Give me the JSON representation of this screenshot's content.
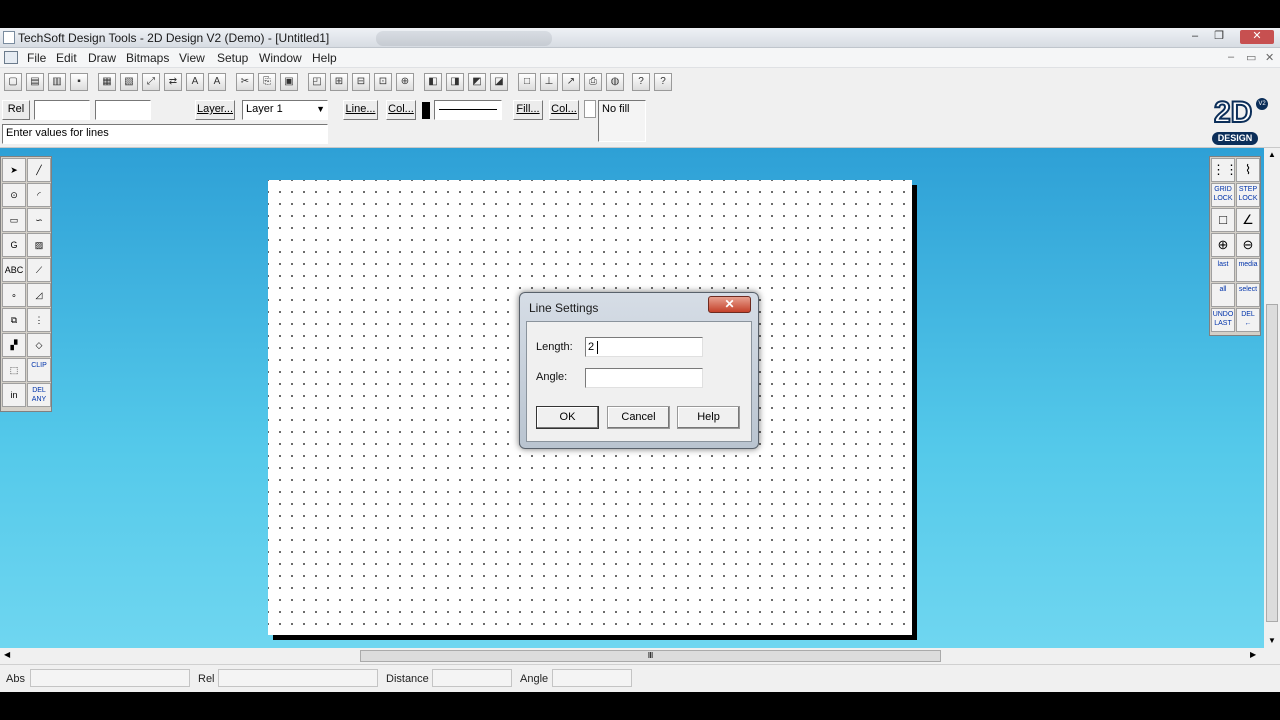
{
  "window": {
    "title": "TechSoft Design Tools - 2D Design V2 (Demo) - [Untitled1]",
    "controls": {
      "minimize": "–",
      "restore": "❐",
      "close": "✕"
    },
    "mdi_controls": {
      "minimize": "–",
      "restore": "▭",
      "close": "✕"
    }
  },
  "menu": {
    "items": [
      "File",
      "Edit",
      "Draw",
      "Bitmaps",
      "View",
      "Setup",
      "Window",
      "Help"
    ]
  },
  "toolbar": {
    "buttons": [
      {
        "name": "new-icon",
        "glyph": "▢"
      },
      {
        "name": "open-icon",
        "glyph": "▤"
      },
      {
        "name": "open-folder-icon",
        "glyph": "▥"
      },
      {
        "name": "save-icon",
        "glyph": "▪"
      },
      {
        "name": "print-icon",
        "glyph": "▦"
      },
      {
        "name": "print-preview-icon",
        "glyph": "▧"
      },
      {
        "name": "rotate-icon",
        "glyph": "⤢"
      },
      {
        "name": "mirror-icon",
        "glyph": "⇄"
      },
      {
        "name": "text-tool-icon",
        "glyph": "A"
      },
      {
        "name": "text-style-icon",
        "glyph": "A"
      },
      {
        "name": "cut-icon",
        "glyph": "✂"
      },
      {
        "name": "copy-icon",
        "glyph": "⎘"
      },
      {
        "name": "paste-icon",
        "glyph": "▣"
      },
      {
        "name": "select-icon",
        "glyph": "◰"
      },
      {
        "name": "group-icon",
        "glyph": "⊞"
      },
      {
        "name": "ungroup-icon",
        "glyph": "⊟"
      },
      {
        "name": "align-icon",
        "glyph": "⊡"
      },
      {
        "name": "distribute-icon",
        "glyph": "⊕"
      },
      {
        "name": "bring-front-icon",
        "glyph": "◧"
      },
      {
        "name": "send-back-icon",
        "glyph": "◨"
      },
      {
        "name": "hatch-icon",
        "glyph": "◩"
      },
      {
        "name": "fill-icon",
        "glyph": "◪"
      },
      {
        "name": "frame-icon",
        "glyph": "□"
      },
      {
        "name": "dimension-icon",
        "glyph": "⊥"
      },
      {
        "name": "measure-icon",
        "glyph": "↗"
      },
      {
        "name": "output-icon",
        "glyph": "⎙"
      },
      {
        "name": "web-icon",
        "glyph": "◍"
      },
      {
        "name": "context-help-icon",
        "glyph": "?"
      },
      {
        "name": "help-icon",
        "glyph": "?"
      }
    ]
  },
  "props": {
    "rel_label": "Rel",
    "layer_button": "Layer...",
    "layer_value": "Layer 1",
    "line_button": "Line...",
    "col_button": "Col...",
    "fill_button": "Fill...",
    "col2_button": "Col...",
    "fill_value": "No fill",
    "prompt": "Enter values for lines"
  },
  "logo": {
    "big": "2D",
    "small": "DESIGN",
    "badge": "V2"
  },
  "left_tools": [
    {
      "name": "pointer-tool-icon",
      "label": "➤"
    },
    {
      "name": "line-tool-icon",
      "label": "╱"
    },
    {
      "name": "circle-tool-icon",
      "label": "⊙"
    },
    {
      "name": "arc-tool-icon",
      "label": "◜"
    },
    {
      "name": "rectangle-tool-icon",
      "label": "▭"
    },
    {
      "name": "curve-tool-icon",
      "label": "∽"
    },
    {
      "name": "spiral-tool-icon",
      "label": "G"
    },
    {
      "name": "hatch-tool-icon",
      "label": "▨"
    },
    {
      "name": "text-tool-icon",
      "label": "ABC"
    },
    {
      "name": "dimension-tool-icon",
      "label": "⟋"
    },
    {
      "name": "points-tool-icon",
      "label": "∘"
    },
    {
      "name": "trim-tool-icon",
      "label": "◿"
    },
    {
      "name": "scale-tool-icon",
      "label": "⧉"
    },
    {
      "name": "array-tool-icon",
      "label": "⋮"
    },
    {
      "name": "node-tool-icon",
      "label": "▞"
    },
    {
      "name": "eraser-tool-icon",
      "label": "◇"
    },
    {
      "name": "box-tool-icon",
      "label": "⬚"
    },
    {
      "name": "clip-tool-icon",
      "label": "CLIP"
    },
    {
      "name": "delete-in-tool-icon",
      "label": "in"
    },
    {
      "name": "delete-any-tool-icon",
      "label": "DEL ANY"
    }
  ],
  "right_tools": [
    {
      "name": "grid-icon",
      "label": "⋮⋮"
    },
    {
      "name": "snap-icon",
      "label": "⌇"
    },
    {
      "name": "grid-lock-icon",
      "label": "GRID LOCK"
    },
    {
      "name": "step-lock-icon",
      "label": "STEP LOCK"
    },
    {
      "name": "ortho-icon",
      "label": "□"
    },
    {
      "name": "angle-icon",
      "label": "∠"
    },
    {
      "name": "zoom-in-icon",
      "label": "⊕"
    },
    {
      "name": "zoom-out-icon",
      "label": "⊖"
    },
    {
      "name": "zoom-last-icon",
      "label": "last"
    },
    {
      "name": "zoom-media-icon",
      "label": "media"
    },
    {
      "name": "zoom-all-icon",
      "label": "all"
    },
    {
      "name": "zoom-select-icon",
      "label": "select"
    },
    {
      "name": "undo-last-icon",
      "label": "UNDO LAST"
    },
    {
      "name": "delete-last-icon",
      "label": "DEL ←"
    }
  ],
  "status": {
    "abs_label": "Abs",
    "rel_label": "Rel",
    "distance_label": "Distance",
    "angle_label": "Angle",
    "scroll_thumb_glyph": "Ⅲ"
  },
  "dialog": {
    "title": "Line Settings",
    "close": "✕",
    "length_label": "Length:",
    "length_value": "2",
    "angle_label": "Angle:",
    "angle_value": "",
    "ok": "OK",
    "cancel": "Cancel",
    "help": "Help"
  }
}
